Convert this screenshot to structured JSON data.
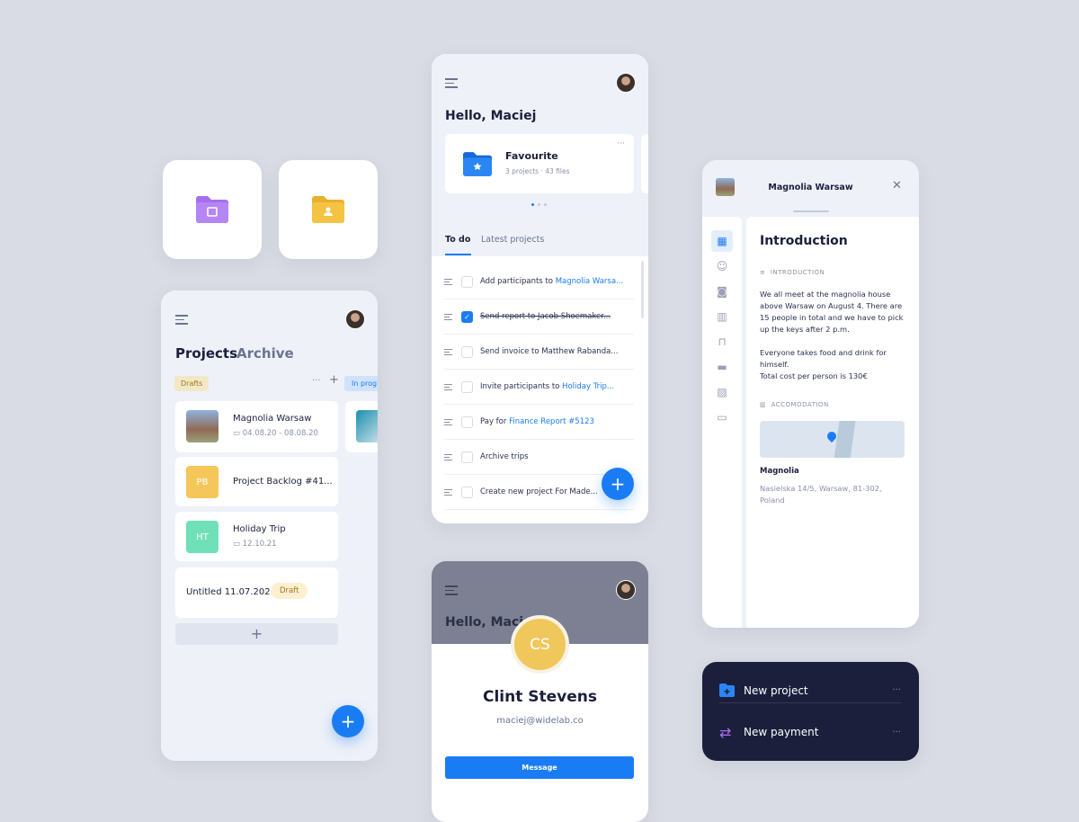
{
  "colors": {
    "accent": "#1a7cf5",
    "background": "#d9dce4",
    "dark_card": "#1b1f3b",
    "purple": "#a66ef0",
    "yellow": "#f4c342",
    "green": "#6fe0b8"
  },
  "tiles": [
    {
      "icon": "folder-calendar-icon",
      "color": "#a66ef0"
    },
    {
      "icon": "folder-person-icon",
      "color": "#f4c342"
    }
  ],
  "projects": {
    "tab_active": "Projects",
    "tab_inactive": "Archive",
    "column_drafts": "Drafts",
    "column_in_progress": "In prog",
    "items": [
      {
        "title": "Magnolia Warsaw",
        "date": "04.08.20 - 08.08.20"
      },
      {
        "initials": "PB",
        "title": "Project Backlog #41..."
      },
      {
        "initials": "HT",
        "title": "Holiday Trip",
        "date": "12.10.21"
      },
      {
        "title": "Untitled 11.07.2021",
        "badge": "Draft"
      }
    ],
    "more": "···",
    "add": "+",
    "fab": "+"
  },
  "home": {
    "greeting": "Hello, Maciej",
    "folder": {
      "title": "Favourite",
      "projects": "3 projects",
      "files": "43 files",
      "more": "···"
    },
    "tabs": [
      "To do",
      "Latest projects"
    ],
    "todos": [
      {
        "text": "Add participants to ",
        "link": "Magnolia Warsa...",
        "done": false
      },
      {
        "text": "Send report to Jacob Shoemaker...",
        "link": "",
        "done": true
      },
      {
        "text": "Send invoice to Matthew Rabanda...",
        "link": "",
        "done": false
      },
      {
        "text": "Invite participants to ",
        "link": "Holiday Trip...",
        "done": false
      },
      {
        "text": "Pay for ",
        "link": "Finance Report #5123",
        "done": false
      },
      {
        "text": "Archive trips",
        "link": "",
        "done": false
      },
      {
        "text": "Create new project For Made...",
        "link": "",
        "done": false
      }
    ],
    "fab": "+"
  },
  "profile": {
    "greeting": "Hello, Macie",
    "initials": "CS",
    "name": "Clint Stevens",
    "email": "maciej@widelab.co",
    "button": "Message"
  },
  "detail": {
    "title": "Magnolia Warsaw",
    "close": "✕",
    "heading": "Introduction",
    "section1": "INTRODUCTION",
    "para1": "We all meet at the magnolia house above Warsaw on August 4. There are 15 people in total and we have to pick up the keys after 2 p.m.",
    "para2": "Everyone takes food and drink for himself.",
    "para3": "Total cost per person is 130€",
    "section2": "ACCOMODATION",
    "place": "Magnolia",
    "address": "Nasielska 14/5, Warsaw, 81-302, Poland",
    "side_icons": [
      "calendar-icon",
      "face-icon",
      "camera-icon",
      "map-icon",
      "bag-icon",
      "bed-icon",
      "image-icon",
      "inbox-icon"
    ]
  },
  "actions": [
    {
      "label": "New project",
      "icon": "folder-plus-icon",
      "more": "···"
    },
    {
      "label": "New payment",
      "icon": "transfer-icon",
      "more": "···"
    }
  ]
}
